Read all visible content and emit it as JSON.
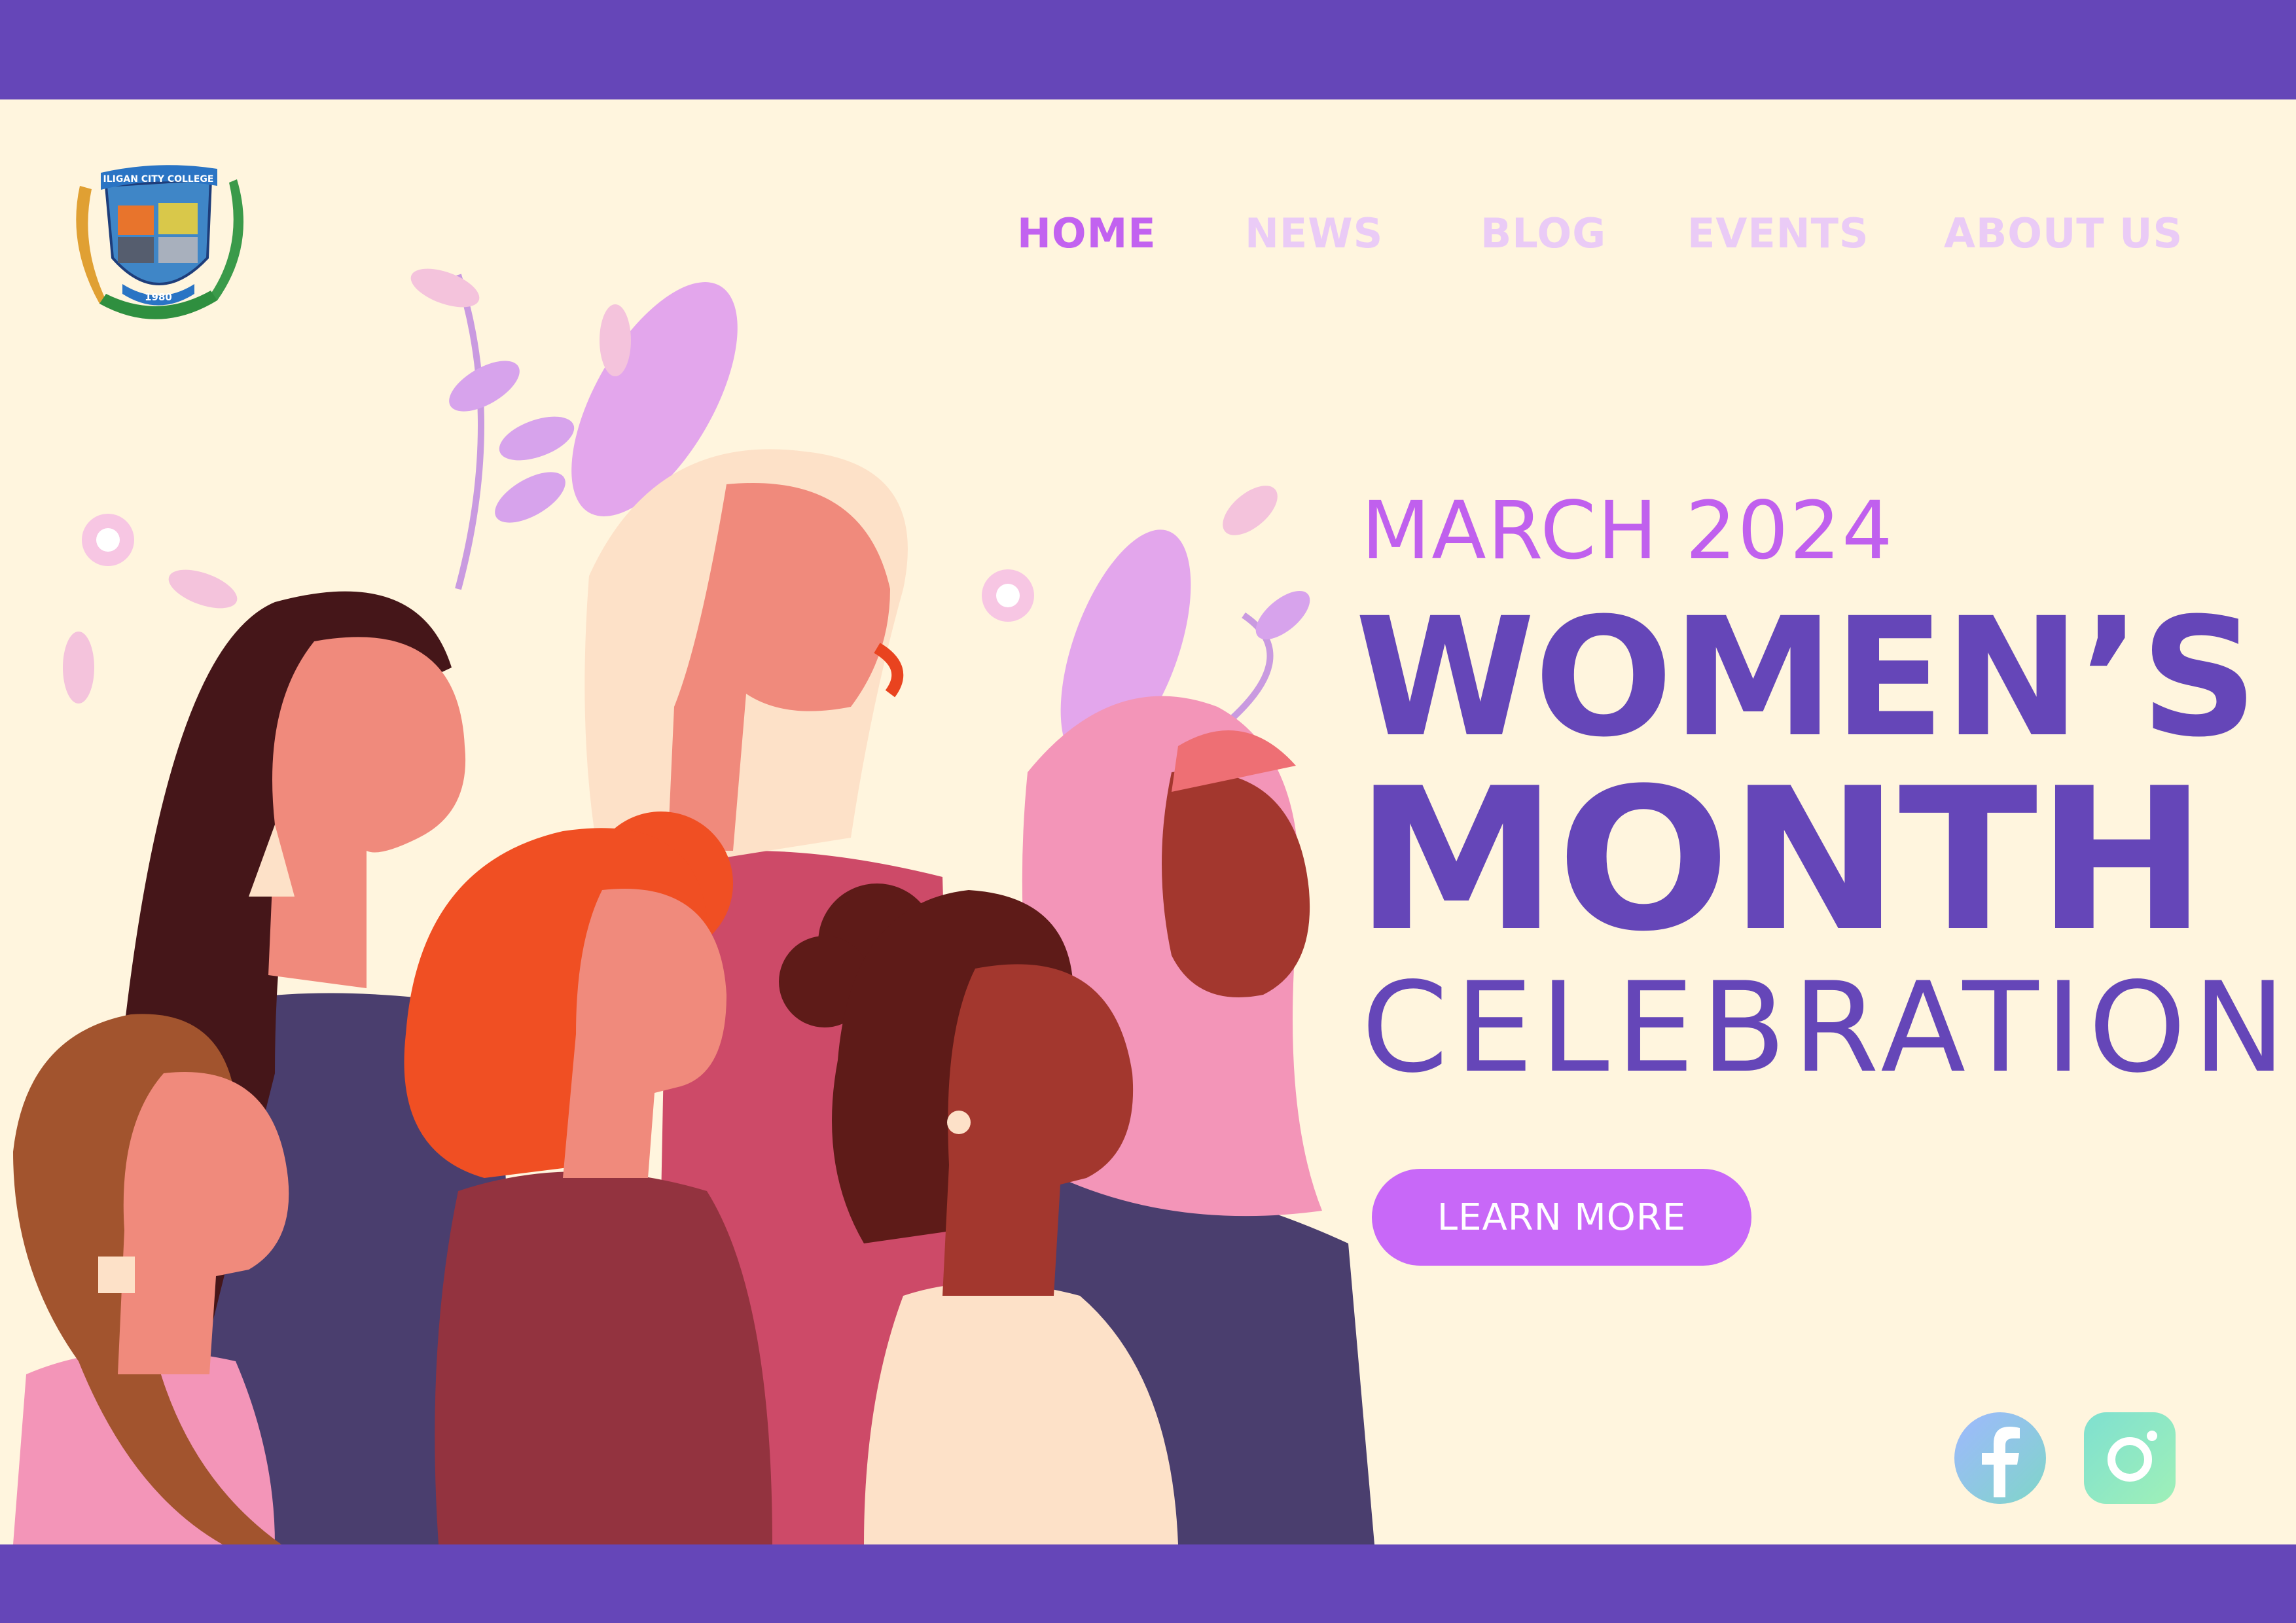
{
  "nav": {
    "home": "HOME",
    "news": "NEWS",
    "blog": "BLOG",
    "events": "EVENTS",
    "about": "ABOUT US"
  },
  "logo": {
    "name": "college-seal",
    "top_text": "ILIGAN CITY COLLEGE",
    "year": "1980"
  },
  "hero": {
    "date": "MARCH 2024",
    "line1": "WOMEN’S",
    "line2": "MONTH",
    "line3": "CELEBRATION",
    "button": "LEARN MORE"
  },
  "social": {
    "facebook_icon": "facebook-icon",
    "instagram_icon": "instagram-icon"
  },
  "colors": {
    "background": "#fff5de",
    "brand_purple": "#6546b8",
    "accent_violet": "#c262f0",
    "nav_inactive": "#eacbf6"
  }
}
